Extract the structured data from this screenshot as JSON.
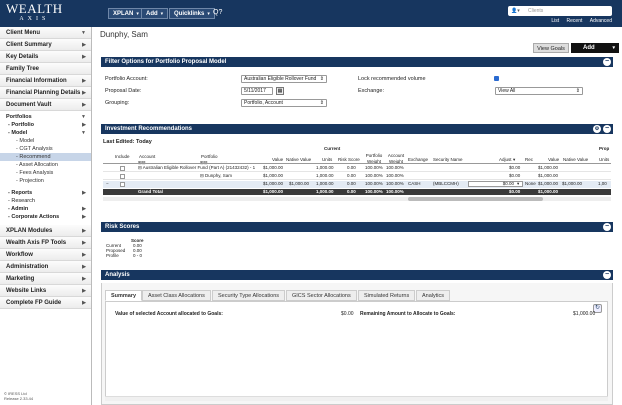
{
  "topbar": {
    "logo_line1": "WEALTH",
    "logo_line2": "AXIS",
    "nav": [
      "XPLAN",
      "Add",
      "Quicklinks"
    ],
    "search_placeholder": "Clients",
    "links": [
      "List",
      "Recent",
      "Advanced"
    ]
  },
  "sidebar": {
    "client_menu": "Client Menu",
    "items_top": [
      "Client Summary",
      "Key Details",
      "Family Tree",
      "Financial Information",
      "Financial Planning Details",
      "Document Vault"
    ],
    "portfolios": "Portfolios",
    "portfolio": "- Portfolio",
    "model": "- Model",
    "model_children": [
      "- Model",
      "- CGT Analysis",
      "- Recommend",
      "- Asset Allocation",
      "- Fees Analysis",
      "- Projection"
    ],
    "after": [
      "- Reports",
      "- Research",
      "- Admin",
      "- Corporate Actions"
    ],
    "bottom": [
      "XPLAN Modules",
      "Wealth Axis FP Tools",
      "Workflow",
      "Administration",
      "Marketing",
      "Website Links",
      "Complete FP Guide"
    ],
    "copyright_1": "© IRESS Ltd",
    "copyright_2": "Release 2.33.44"
  },
  "page": {
    "title": "Dunphy, Sam",
    "view_goals": "View Goals",
    "add": "Add"
  },
  "filter": {
    "header": "Filter Options for Portfolio Proposal Model",
    "account_label": "Portfolio Account:",
    "account_value": "Australian Eligible Rollover Fund",
    "date_label": "Proposal Date:",
    "date_value": "5/11/2017",
    "grouping_label": "Grouping:",
    "grouping_value": "Portfolio, Account",
    "lock_label": "Lock recommended volume",
    "exchange_label": "Exchange:",
    "exchange_value": "View All"
  },
  "invest": {
    "header": "Investment Recommendations",
    "last_edited": "Last Edited: Today",
    "current": "Current",
    "prop": "Prop",
    "cols_left": [
      "Include",
      "Account",
      "Portfolio",
      "Value",
      "Native Value",
      "Units",
      "Risk Score",
      "Portfolio Weight",
      "Account Weight"
    ],
    "cols_right": [
      "Exchange",
      "Security Name",
      "Adjust",
      "Rec",
      "Value",
      "Native Value",
      "Units"
    ],
    "row1": "Australian Eligible Rollover Fund (Part A) (21432432) - 1",
    "row1_vals": [
      "$1,000.00",
      "1,000.00",
      "0.00",
      "100.00%",
      "100.00%"
    ],
    "row1_r": [
      "$0.00",
      "$1,000.00"
    ],
    "row2": "Dunphy, Sam",
    "row2_vals": [
      "$1,000.00",
      "1,000.00",
      "0.00",
      "100.00%",
      "100.00%"
    ],
    "row2_r": [
      "$0.00",
      "$1,000.00"
    ],
    "row3_vals": [
      "$1,000.00",
      "$1,000.00",
      "1,000.00",
      "0.00",
      "100.00%",
      "100.00%"
    ],
    "row3_r": [
      "CASH",
      "(MBLCCMH)",
      "$0.00",
      "None",
      "$1,000.00",
      "$1,000.00",
      "1,00"
    ],
    "total_label": "Grand Total",
    "total_vals": [
      "$1,000.00",
      "1,000.00",
      "0.00",
      "100.00%",
      "100.00%"
    ],
    "total_r": [
      "$0.00",
      "$1,000.00"
    ]
  },
  "risk": {
    "header": "Risk Scores",
    "score_col": "Score",
    "rows": [
      {
        "label": "Current",
        "value": "0.00"
      },
      {
        "label": "Proposed",
        "value": "0.00"
      },
      {
        "label": "Profile",
        "value": "0 - 0"
      }
    ]
  },
  "analysis": {
    "header": "Analysis",
    "tabs": [
      "Summary",
      "Asset Class Allocations",
      "Security Type Allocations",
      "GICS Sector Allocations",
      "Simulated Returns",
      "Analytics"
    ],
    "selected_label": "Value of selected Account allocated to Goals:",
    "selected_value": "$0.00",
    "remaining_label": "Remaining Amount to Allocate to Goals:",
    "remaining_value": "$1,000.00"
  }
}
